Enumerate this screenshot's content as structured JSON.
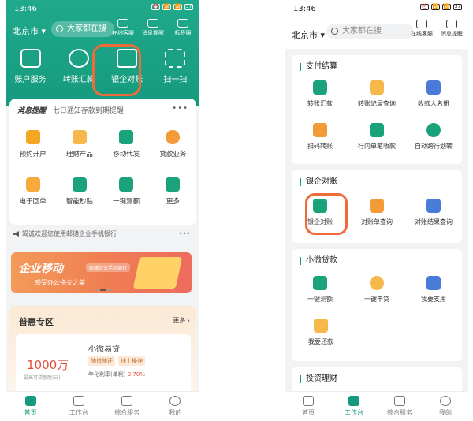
{
  "left": {
    "status": {
      "time": "13:46",
      "icons": [
        "⏰",
        "📶",
        "📶",
        "37"
      ]
    },
    "header": {
      "city": "北京市",
      "search_placeholder": "大家都在搜",
      "tools": [
        {
          "label": "在线客服",
          "icon": "headset-icon"
        },
        {
          "label": "消息提醒",
          "icon": "message-icon"
        },
        {
          "label": "标签服",
          "icon": "gear-icon"
        }
      ]
    },
    "quick": [
      {
        "label": "账户服务",
        "icon": "account-icon",
        "color": "#ffffff"
      },
      {
        "label": "转账汇款",
        "icon": "transfer-icon",
        "color": "#ffffff"
      },
      {
        "label": "银企对账",
        "icon": "reconcile-icon",
        "color": "#ffffff"
      },
      {
        "label": "扫一扫",
        "icon": "scan-icon",
        "color": "#ffffff"
      }
    ],
    "message": {
      "title": "消息提醒",
      "subtitle": "七日通知存款到期提醒"
    },
    "grid": [
      [
        {
          "label": "预约开户",
          "icon": "appointment-icon",
          "color": "#f5a623"
        },
        {
          "label": "理财产品",
          "icon": "finance-icon",
          "color": "#f7b84b"
        },
        {
          "label": "移动代发",
          "icon": "payroll-icon",
          "color": "#1aa37a"
        },
        {
          "label": "贷款业务",
          "icon": "loan-icon",
          "color": "#f29b38"
        }
      ],
      [
        {
          "label": "电子回单",
          "icon": "receipt-icon",
          "color": "#f7a93b"
        },
        {
          "label": "智能秒贴",
          "icon": "ticket-icon",
          "color": "#1aa37a"
        },
        {
          "label": "一键测额",
          "icon": "calc-icon",
          "color": "#1aa37a"
        },
        {
          "label": "更多",
          "icon": "more-icon",
          "color": "#1aa37a"
        }
      ]
    ],
    "notice": "竭诚欢迎您使用邮储企业手机银行",
    "banner": {
      "title": "企业移动",
      "tag": "邮储企业手机银行",
      "subtitle": "感受办公指尖之美"
    },
    "puhui": {
      "title": "普惠专区",
      "more": "更多",
      "loan": {
        "amount": "1000万",
        "amount_sub": "最高可贷额度(元)",
        "name": "小微易贷",
        "tags": [
          "随借随还",
          "线上操作"
        ],
        "rate_label": "年化利率(单利)",
        "rate": "3.70%"
      }
    },
    "tabs": [
      {
        "label": "首页",
        "icon": "home-icon",
        "active": true
      },
      {
        "label": "工作台",
        "icon": "workbench-icon",
        "active": false
      },
      {
        "label": "综合服务",
        "icon": "service-icon",
        "active": false
      },
      {
        "label": "我的",
        "icon": "profile-icon",
        "active": false
      }
    ]
  },
  "right": {
    "status": {
      "time": "13:46",
      "icons": [
        "⏰",
        "📶",
        "📶",
        "37"
      ]
    },
    "header": {
      "city": "北京市",
      "search_placeholder": "大家都在搜",
      "tools": [
        {
          "label": "在线客服",
          "icon": "headset-icon"
        },
        {
          "label": "消息提醒",
          "icon": "message-icon"
        }
      ]
    },
    "sections": [
      {
        "title": "支付结算",
        "rows": [
          [
            {
              "label": "转账汇款",
              "icon": "transfer-icon",
              "color": "#1aa37a"
            },
            {
              "label": "转账记录查询",
              "icon": "record-icon",
              "color": "#f7b84b"
            },
            {
              "label": "收款人名册",
              "icon": "payee-icon",
              "color": "#4a7bd8"
            }
          ],
          [
            {
              "label": "扫码转账",
              "icon": "qr-icon",
              "color": "#f29b38"
            },
            {
              "label": "行内单笔收款",
              "icon": "collect-icon",
              "color": "#1aa37a"
            },
            {
              "label": "自动跨行划转",
              "icon": "auto-transfer-icon",
              "color": "#1aa37a"
            }
          ]
        ]
      },
      {
        "title": "银企对账",
        "rows": [
          [
            {
              "label": "银企对账",
              "icon": "reconcile-icon",
              "color": "#1aa37a"
            },
            {
              "label": "对账单查询",
              "icon": "statement-icon",
              "color": "#f29b38"
            },
            {
              "label": "对账结果查询",
              "icon": "result-icon",
              "color": "#4a7bd8"
            }
          ]
        ]
      },
      {
        "title": "小微贷款",
        "rows": [
          [
            {
              "label": "一键测额",
              "icon": "calc-icon",
              "color": "#1aa37a"
            },
            {
              "label": "一键申贷",
              "icon": "apply-icon",
              "color": "#f7b84b"
            },
            {
              "label": "我要支用",
              "icon": "withdraw-icon",
              "color": "#4a7bd8"
            }
          ],
          [
            {
              "label": "我要还款",
              "icon": "repay-icon",
              "color": "#f7b84b"
            }
          ]
        ]
      },
      {
        "title": "投资理财",
        "rows": []
      }
    ],
    "tabs": [
      {
        "label": "首页",
        "icon": "home-icon",
        "active": false
      },
      {
        "label": "工作台",
        "icon": "workbench-icon",
        "active": true
      },
      {
        "label": "综合服务",
        "icon": "service-icon",
        "active": false
      },
      {
        "label": "我的",
        "icon": "profile-icon",
        "active": false
      }
    ]
  }
}
